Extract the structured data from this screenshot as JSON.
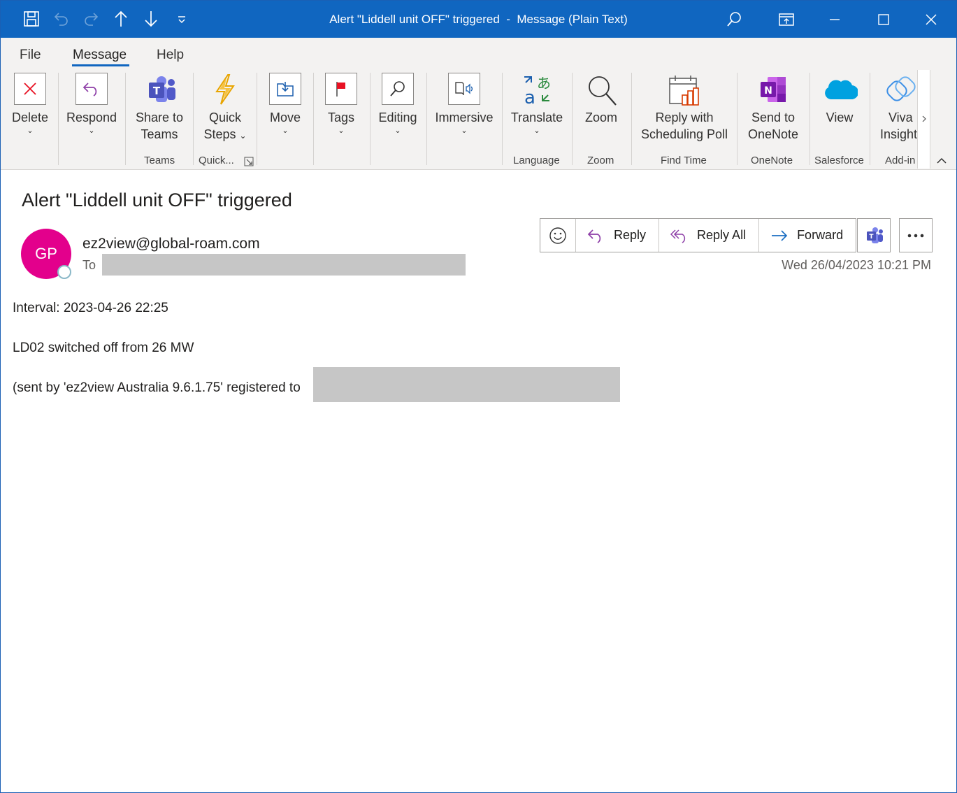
{
  "titlebar": {
    "title": "Alert \"Liddell unit OFF\" triggered  -  Message (Plain Text)"
  },
  "tabs": [
    {
      "label": "File"
    },
    {
      "label": "Message",
      "active": true
    },
    {
      "label": "Help"
    }
  ],
  "ribbon": {
    "delete": "Delete",
    "respond": "Respond",
    "share_line1": "Share to",
    "share_line2": "Teams",
    "quick_line1": "Quick",
    "quick_line2": "Steps",
    "move": "Move",
    "tags": "Tags",
    "editing": "Editing",
    "immersive": "Immersive",
    "translate": "Translate",
    "zoom": "Zoom",
    "reply_poll_line1": "Reply with",
    "reply_poll_line2": "Scheduling Poll",
    "onenote_line1": "Send to",
    "onenote_line2": "OneNote",
    "view": "View",
    "viva_line1": "Viva",
    "viva_line2": "Insight",
    "groups": {
      "teams": "Teams",
      "quick": "Quick...",
      "language": "Language",
      "zoom": "Zoom",
      "find_time": "Find Time",
      "onenote": "OneNote",
      "salesforce": "Salesforce",
      "addins": "Add-in"
    }
  },
  "message": {
    "subject": "Alert \"Liddell unit OFF\" triggered",
    "avatar_initials": "GP",
    "sender": "ez2view@global-roam.com",
    "to_label": "To",
    "date": "Wed 26/04/2023 10:21 PM",
    "actions": {
      "reply": "Reply",
      "reply_all": "Reply All",
      "forward": "Forward"
    },
    "body": {
      "line1": "Interval: 2023-04-26 22:25",
      "line2": "LD02 switched off from 26 MW",
      "line3": "(sent by 'ez2view Australia 9.6.1.75' registered to"
    }
  },
  "colors": {
    "titlebar": "#1066c0",
    "avatar": "#e3008c",
    "ribbon_bg": "#f3f2f1",
    "accent_purple": "#8e3fa8"
  }
}
